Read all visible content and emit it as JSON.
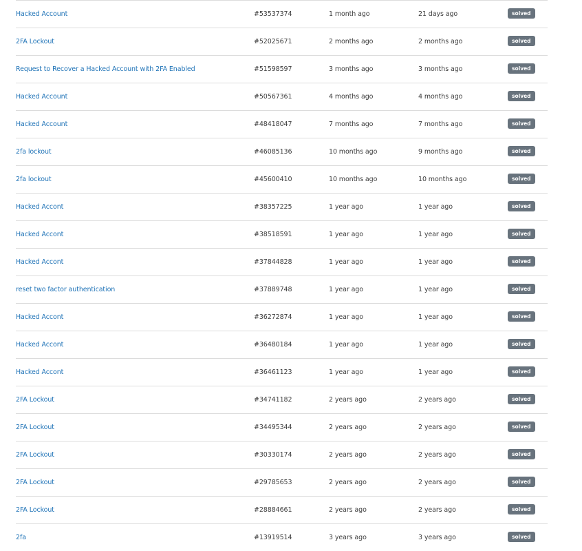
{
  "requests": [
    {
      "subject": "Hacked Account",
      "id": "#53537374",
      "created": "1 month ago",
      "updated": "21 days ago",
      "status": "solved"
    },
    {
      "subject": "2FA Lockout",
      "id": "#52025671",
      "created": "2 months ago",
      "updated": "2 months ago",
      "status": "solved"
    },
    {
      "subject": "Request to Recover a Hacked Account with 2FA Enabled",
      "id": "#51598597",
      "created": "3 months ago",
      "updated": "3 months ago",
      "status": "solved"
    },
    {
      "subject": "Hacked Account",
      "id": "#50567361",
      "created": "4 months ago",
      "updated": "4 months ago",
      "status": "solved"
    },
    {
      "subject": "Hacked Account",
      "id": "#48418047",
      "created": "7 months ago",
      "updated": "7 months ago",
      "status": "solved"
    },
    {
      "subject": "2fa lockout",
      "id": "#46085136",
      "created": "10 months ago",
      "updated": "9 months ago",
      "status": "solved"
    },
    {
      "subject": "2fa lockout",
      "id": "#45600410",
      "created": "10 months ago",
      "updated": "10 months ago",
      "status": "solved"
    },
    {
      "subject": "Hacked Accont",
      "id": "#38357225",
      "created": "1 year ago",
      "updated": "1 year ago",
      "status": "solved"
    },
    {
      "subject": "Hacked Accont",
      "id": "#38518591",
      "created": "1 year ago",
      "updated": "1 year ago",
      "status": "solved"
    },
    {
      "subject": "Hacked Accont",
      "id": "#37844828",
      "created": "1 year ago",
      "updated": "1 year ago",
      "status": "solved"
    },
    {
      "subject": "reset two factor authentication",
      "id": "#37889748",
      "created": "1 year ago",
      "updated": "1 year ago",
      "status": "solved"
    },
    {
      "subject": "Hacked Accont",
      "id": "#36272874",
      "created": "1 year ago",
      "updated": "1 year ago",
      "status": "solved"
    },
    {
      "subject": "Hacked Accont",
      "id": "#36480184",
      "created": "1 year ago",
      "updated": "1 year ago",
      "status": "solved"
    },
    {
      "subject": "Hacked Accont",
      "id": "#36461123",
      "created": "1 year ago",
      "updated": "1 year ago",
      "status": "solved"
    },
    {
      "subject": "2FA Lockout",
      "id": "#34741182",
      "created": "2 years ago",
      "updated": "2 years ago",
      "status": "solved"
    },
    {
      "subject": "2FA Lockout",
      "id": "#34495344",
      "created": "2 years ago",
      "updated": "2 years ago",
      "status": "solved"
    },
    {
      "subject": "2FA Lockout",
      "id": "#30330174",
      "created": "2 years ago",
      "updated": "2 years ago",
      "status": "solved"
    },
    {
      "subject": "2FA Lockout",
      "id": "#29785653",
      "created": "2 years ago",
      "updated": "2 years ago",
      "status": "solved"
    },
    {
      "subject": "2FA Lockout",
      "id": "#28884661",
      "created": "2 years ago",
      "updated": "2 years ago",
      "status": "solved"
    },
    {
      "subject": "2fa",
      "id": "#13919514",
      "created": "3 years ago",
      "updated": "3 years ago",
      "status": "solved"
    }
  ],
  "colors": {
    "link": "#1f73b7",
    "text": "#3d3d3d",
    "badge_bg": "#68737d",
    "divider": "#dcdcdc"
  }
}
